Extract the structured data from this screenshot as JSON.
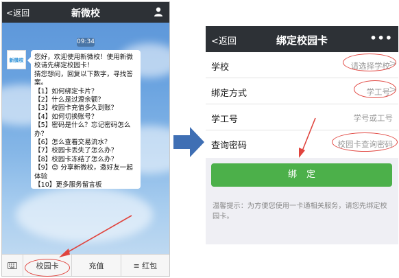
{
  "left": {
    "back_label": "返回",
    "title": "新微校",
    "timestamp": "09:34",
    "avatar_text": "新微校",
    "message_lines": [
      "您好，欢迎使用新微校！使用新微",
      "校请先绑定校园卡！",
      "猜您想问，回复以下数字，寻找答",
      "案。",
      "【1】如何绑定卡片？",
      "【2】什么是过渡余额？",
      "【3】校园卡充值多久到账？",
      "【4】如何切换账号？",
      "【5】密码是什么？忘记密码怎么",
      "办？",
      "【6】怎么查看交易流水？",
      "【7】校园卡丢失了怎么办？",
      "【8】校园卡冻结了怎么办？",
      "【9】😊 分享新微校，邀好友一起",
      "体验",
      "【10】更多服务留言板"
    ],
    "bottom_tabs": [
      "校园卡",
      "充值",
      "≡ 红包"
    ]
  },
  "right": {
    "back_label": "返回",
    "title": "绑定校园卡",
    "more_label": "•••",
    "rows": [
      {
        "label": "学校",
        "value": "请选择学校"
      },
      {
        "label": "绑定方式",
        "value": "学工号"
      },
      {
        "label": "学工号",
        "value": "学号或工号"
      },
      {
        "label": "查询密码",
        "value": "校园卡查询密码"
      }
    ],
    "bind_button": "绑定",
    "tip_text": "温馨提示：为方便您使用一卡通相关服务，请您先绑定校园卡。"
  },
  "colors": {
    "topbar": "#2d3136",
    "bind_button": "#4cb04a",
    "annotation_red": "#e0443e",
    "annotation_arrow_blue": "#3f6fb4"
  }
}
